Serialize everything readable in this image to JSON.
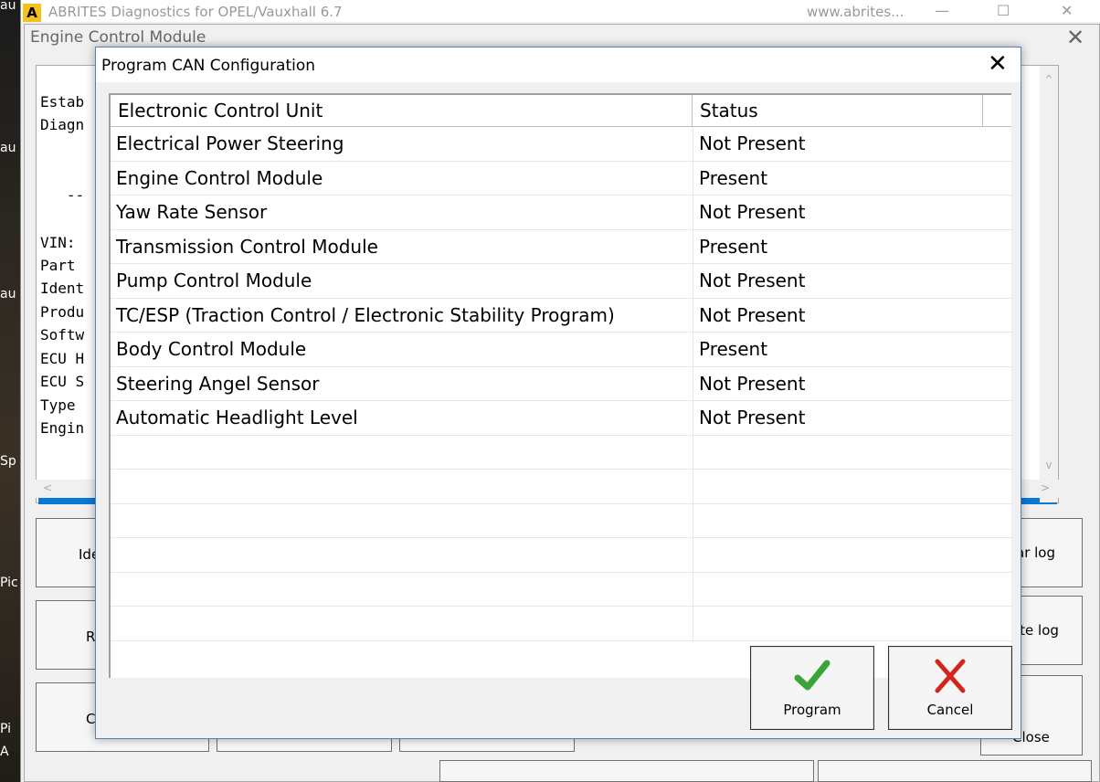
{
  "desktop": {
    "labels": [
      "au",
      "au",
      "au",
      "Sp",
      "Pic",
      "Pi",
      "A"
    ]
  },
  "main_window": {
    "logo": "A",
    "title": "ABRITES Diagnostics for OPEL/Vauxhall 6.7",
    "site": "www.abrites...",
    "minimize": "—",
    "maximize": "☐",
    "close": "✕"
  },
  "ecm_window": {
    "title": "Engine Control Module",
    "close": "✕",
    "log_lines": [
      "Estab",
      "Diagn",
      "",
      "",
      "   --",
      "",
      "VIN:",
      "Part",
      "Ident",
      "Produ",
      "Softw",
      "ECU H",
      "ECU S",
      "Type",
      "Engin"
    ],
    "scroll_up": "^",
    "scroll_down": "v",
    "scroll_left": "<",
    "scroll_right": ">",
    "bg_buttons": [
      "Ide",
      "R",
      "C",
      "ar log",
      "ite log",
      "Close"
    ]
  },
  "dialog": {
    "title": "Program CAN Configuration",
    "close": "✕",
    "columns": [
      "Electronic Control Unit",
      "Status"
    ],
    "rows": [
      [
        "Electrical Power Steering",
        "Not Present"
      ],
      [
        "Engine Control Module",
        "Present"
      ],
      [
        "Yaw Rate Sensor",
        "Not Present"
      ],
      [
        "Transmission Control Module",
        "Present"
      ],
      [
        "Pump Control Module",
        "Not Present"
      ],
      [
        "TC/ESP (Traction Control / Electronic Stability Program)",
        "Not Present"
      ],
      [
        "Body Control Module",
        "Present"
      ],
      [
        "Steering Angel Sensor",
        "Not Present"
      ],
      [
        "Automatic Headlight Level",
        "Not Present"
      ]
    ],
    "program_label": "Program",
    "cancel_label": "Cancel",
    "program_icon": "checkmark-icon",
    "cancel_icon": "x-icon",
    "colors": {
      "check": "#3aa33a",
      "cross": "#d3261b"
    }
  }
}
